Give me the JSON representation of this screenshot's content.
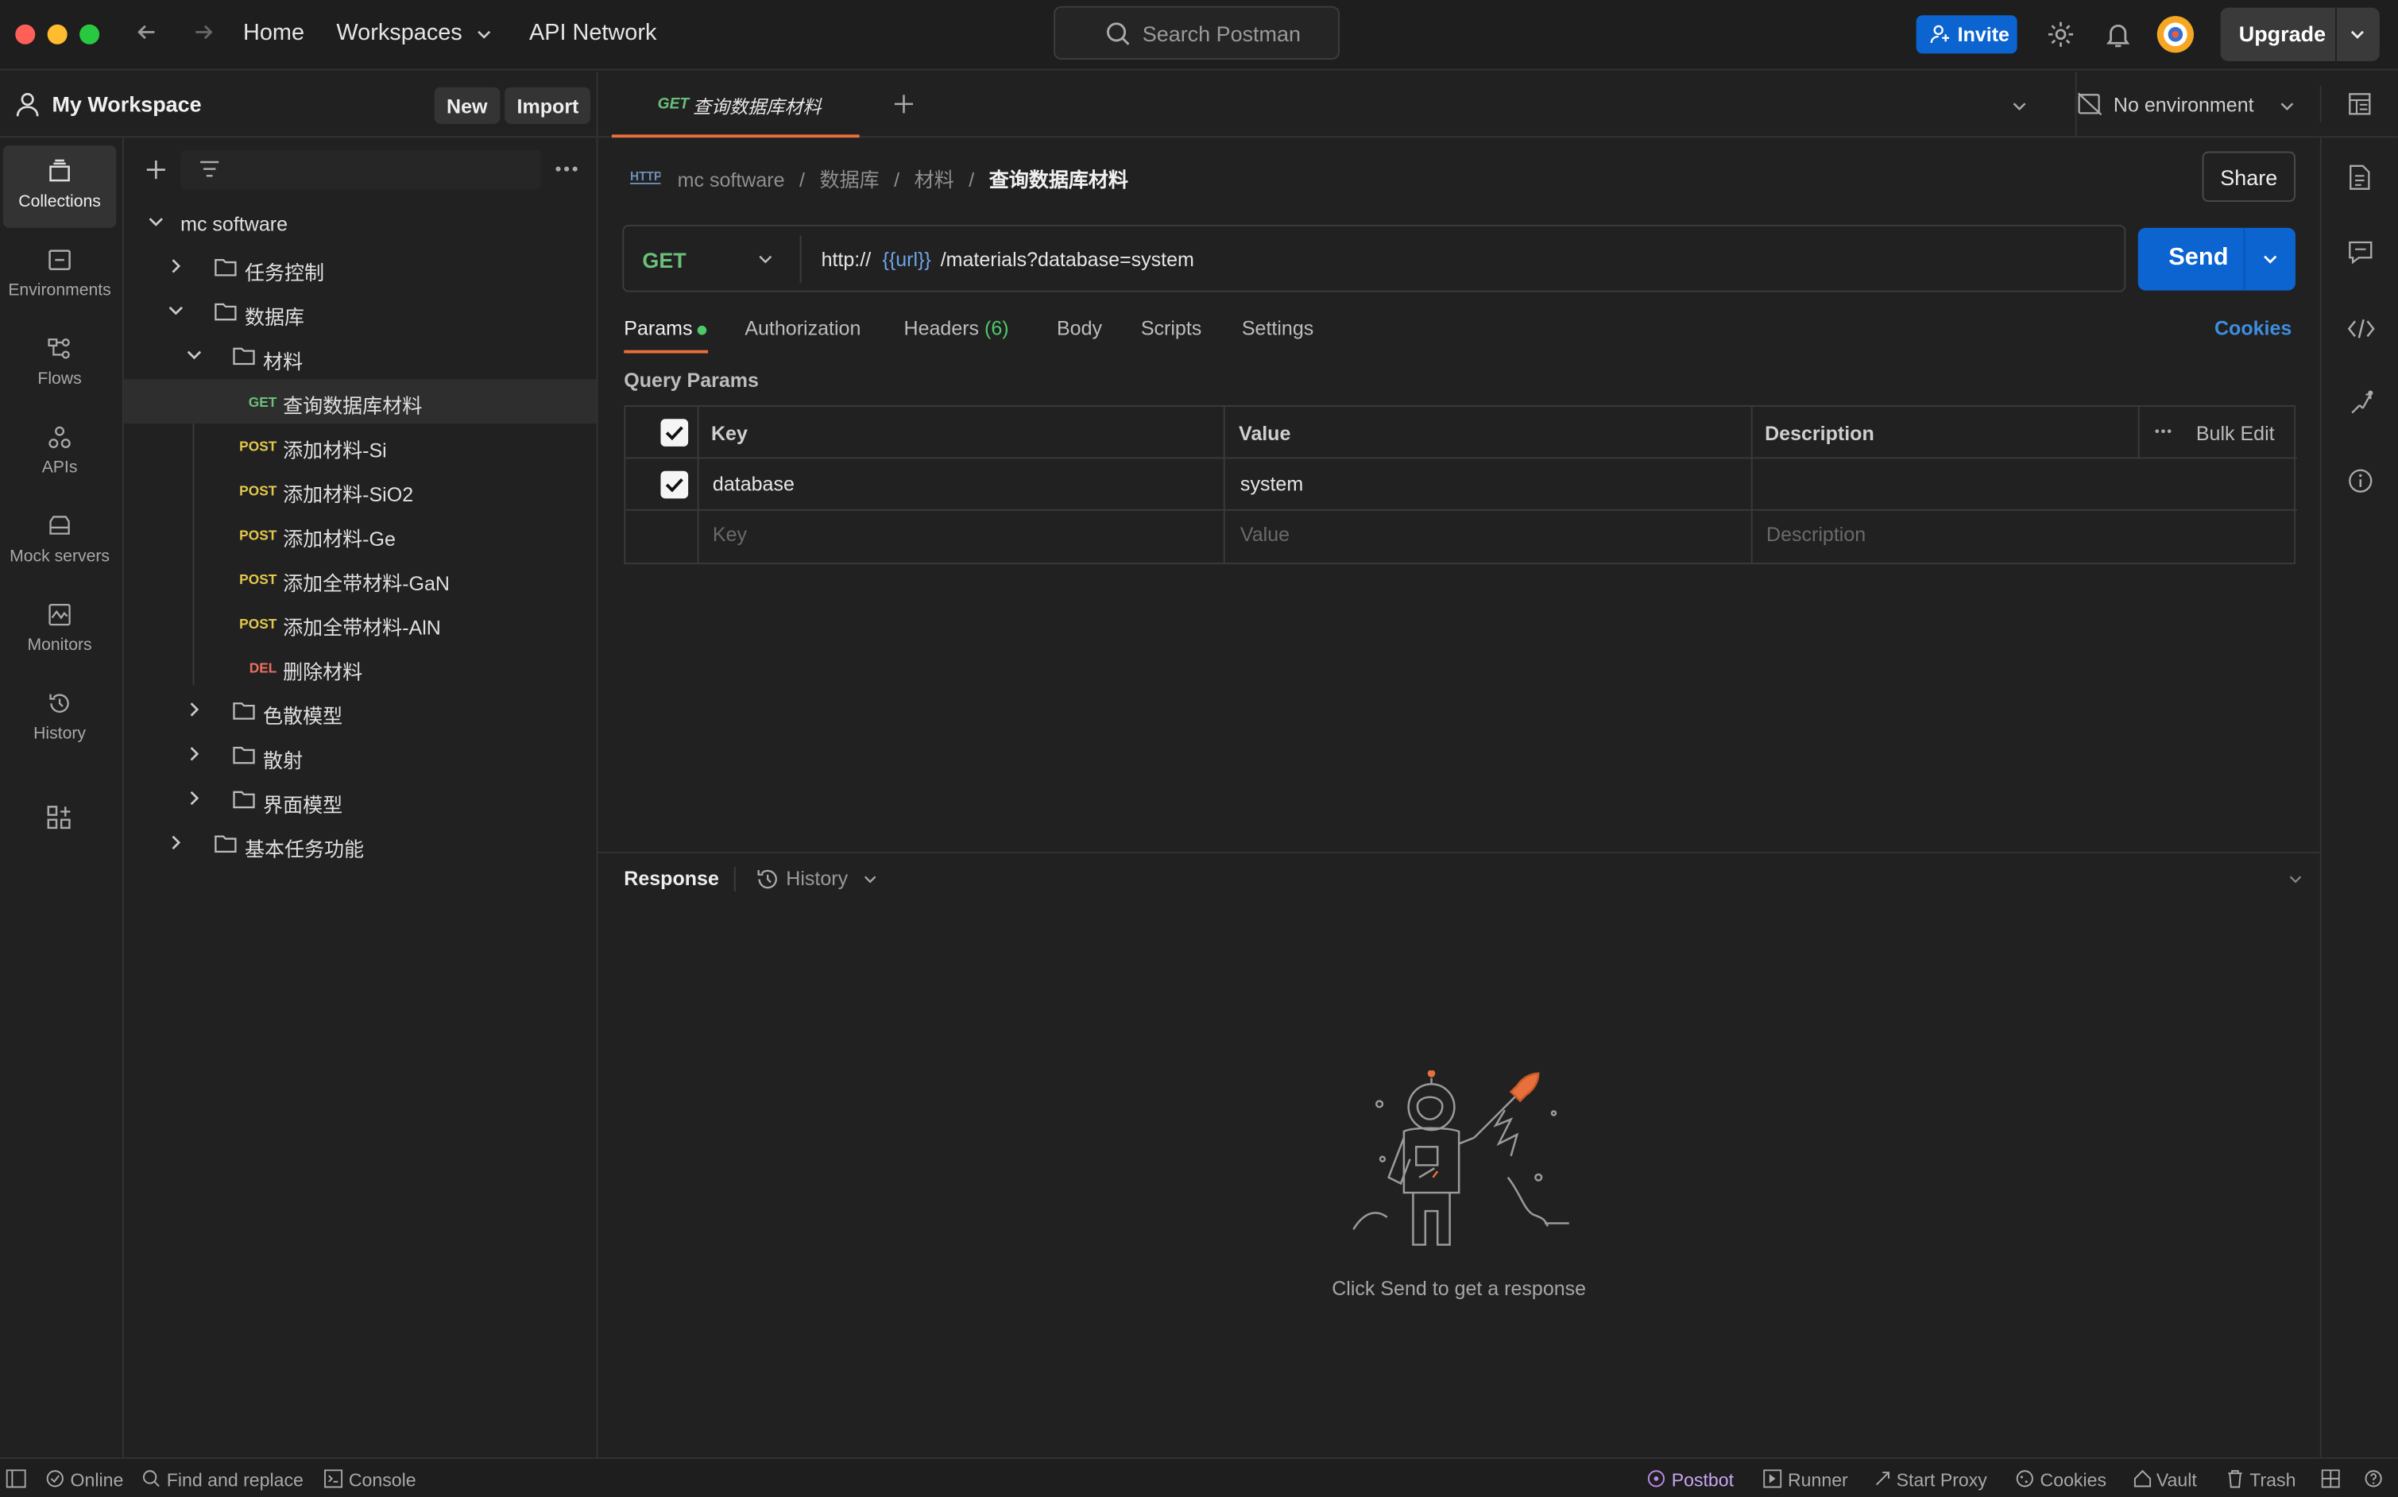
{
  "topbar": {
    "nav": {
      "home": "Home",
      "workspaces": "Workspaces",
      "api_network": "API Network"
    },
    "search_placeholder": "Search Postman",
    "invite_label": "Invite",
    "upgrade_label": "Upgrade"
  },
  "workspace": {
    "title": "My Workspace",
    "new_label": "New",
    "import_label": "Import"
  },
  "rail": {
    "items": [
      {
        "label": "Collections",
        "icon": "collections-icon"
      },
      {
        "label": "Environments",
        "icon": "environments-icon"
      },
      {
        "label": "Flows",
        "icon": "flows-icon"
      },
      {
        "label": "APIs",
        "icon": "apis-icon"
      },
      {
        "label": "Mock servers",
        "icon": "mock-servers-icon"
      },
      {
        "label": "Monitors",
        "icon": "monitors-icon"
      },
      {
        "label": "History",
        "icon": "history-icon"
      }
    ]
  },
  "tree": {
    "collection": "mc software",
    "folders": {
      "f1": "任务控制",
      "f2": "数据库",
      "f3": "材料",
      "f4": "色散模型",
      "f5": "散射",
      "f6": "界面模型",
      "f7": "基本任务功能"
    },
    "requests": [
      {
        "method": "GET",
        "name": "查询数据库材料"
      },
      {
        "method": "POST",
        "name": "添加材料-Si"
      },
      {
        "method": "POST",
        "name": "添加材料-SiO2"
      },
      {
        "method": "POST",
        "name": "添加材料-Ge"
      },
      {
        "method": "POST",
        "name": "添加全带材料-GaN"
      },
      {
        "method": "POST",
        "name": "添加全带材料-AlN"
      },
      {
        "method": "DEL",
        "name": "删除材料"
      }
    ]
  },
  "tab": {
    "method": "GET",
    "title": "查询数据库材料"
  },
  "environment": "No environment",
  "breadcrumb": {
    "c1": "mc software",
    "c2": "数据库",
    "c3": "材料",
    "current": "查询数据库材料"
  },
  "share_label": "Share",
  "request": {
    "method": "GET",
    "url_prefix": "http://",
    "url_var": "{{url}}",
    "url_path": "/materials?database=system",
    "send_label": "Send"
  },
  "subtabs": {
    "params": "Params",
    "authorization": "Authorization",
    "headers": "Headers",
    "headers_count": "(6)",
    "body": "Body",
    "scripts": "Scripts",
    "settings": "Settings",
    "cookies": "Cookies"
  },
  "query_params": {
    "title": "Query Params",
    "headers": {
      "key": "Key",
      "value": "Value",
      "description": "Description",
      "bulk_edit": "Bulk Edit"
    },
    "rows": [
      {
        "key": "database",
        "value": "system",
        "description": "",
        "checked": true
      }
    ],
    "placeholders": {
      "key": "Key",
      "value": "Value",
      "description": "Description"
    }
  },
  "response": {
    "label": "Response",
    "history": "History",
    "empty_message": "Click Send to get a response"
  },
  "statusbar": {
    "online": "Online",
    "find_replace": "Find and replace",
    "console": "Console",
    "postbot": "Postbot",
    "runner": "Runner",
    "start_proxy": "Start Proxy",
    "cookies": "Cookies",
    "vault": "Vault",
    "trash": "Trash"
  },
  "colors": {
    "accent": "#e8703a",
    "primary": "#0b64d0",
    "get": "#6bc17a",
    "post": "#e3c84b",
    "delete": "#e8705f"
  }
}
